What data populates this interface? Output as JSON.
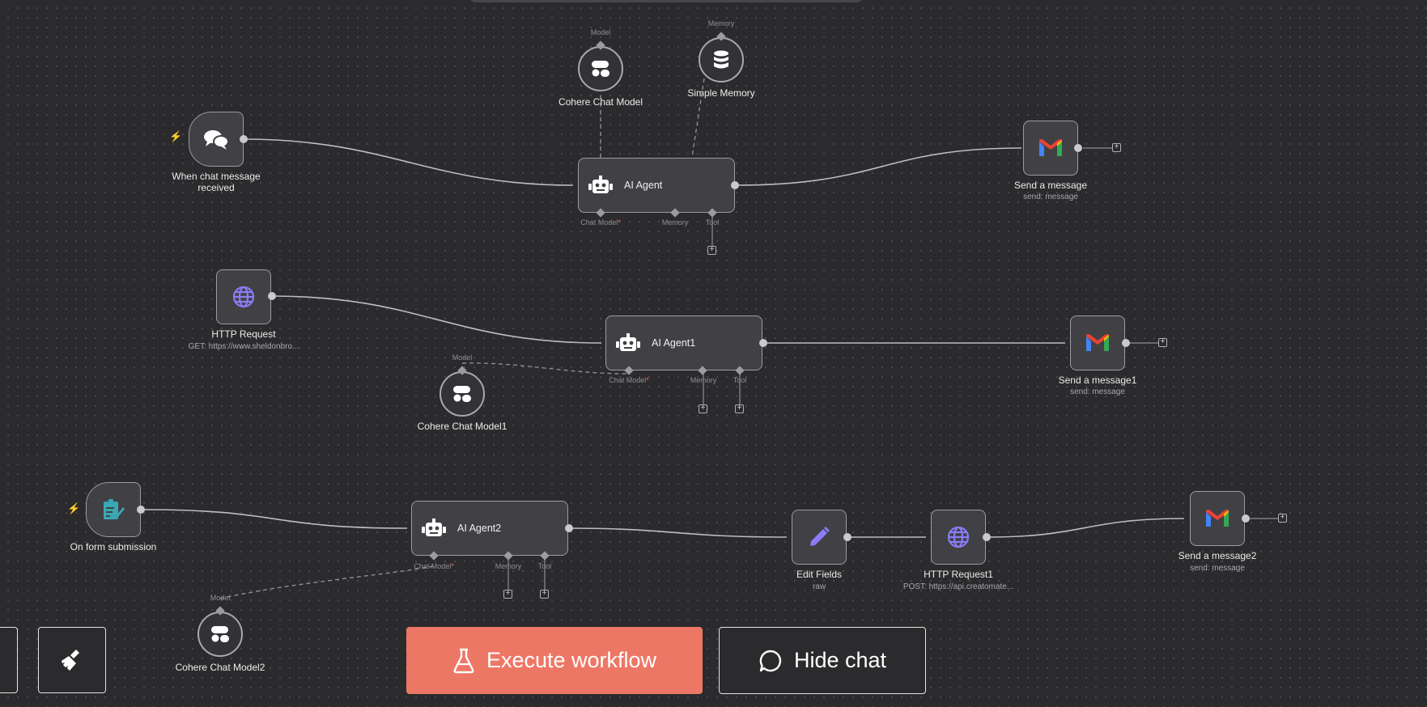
{
  "canvas": {
    "background": "#2b2b2d",
    "accent": "#ff6d5a"
  },
  "nodes": {
    "chat_trigger": {
      "label": "When chat message received",
      "icon": "chat-bubbles-icon"
    },
    "agent": {
      "label": "AI Agent",
      "icon": "robot-icon"
    },
    "cohere": {
      "label": "Cohere Chat Model",
      "icon": "cohere-icon"
    },
    "memory": {
      "label": "Simple Memory",
      "icon": "database-icon"
    },
    "send": {
      "label": "Send a message",
      "sub": "send: message",
      "icon": "gmail-icon"
    },
    "http": {
      "label": "HTTP Request",
      "sub": "GET: https://www.sheldonbro...",
      "icon": "globe-icon"
    },
    "agent1": {
      "label": "AI Agent1",
      "icon": "robot-icon"
    },
    "cohere1": {
      "label": "Cohere Chat Model1",
      "icon": "cohere-icon"
    },
    "send1": {
      "label": "Send a message1",
      "sub": "send: message",
      "icon": "gmail-icon"
    },
    "form": {
      "label": "On form submission",
      "icon": "form-icon"
    },
    "agent2": {
      "label": "AI Agent2",
      "icon": "robot-icon"
    },
    "cohere2": {
      "label": "Cohere Chat Model2",
      "icon": "cohere-icon"
    },
    "edit": {
      "label": "Edit Fields",
      "sub": "raw",
      "icon": "pencil-icon"
    },
    "http1": {
      "label": "HTTP Request1",
      "sub": "POST: https://api.creatomate...",
      "icon": "globe-icon"
    },
    "send2": {
      "label": "Send a message2",
      "sub": "send: message",
      "icon": "gmail-icon"
    }
  },
  "ports": {
    "chat_model": "Chat Model",
    "required": "*",
    "memory": "Memory",
    "tool": "Tool",
    "model": "Model",
    "memory_top": "Memory"
  },
  "toolbar": {
    "execute": "Execute workflow",
    "hide_chat": "Hide chat"
  }
}
